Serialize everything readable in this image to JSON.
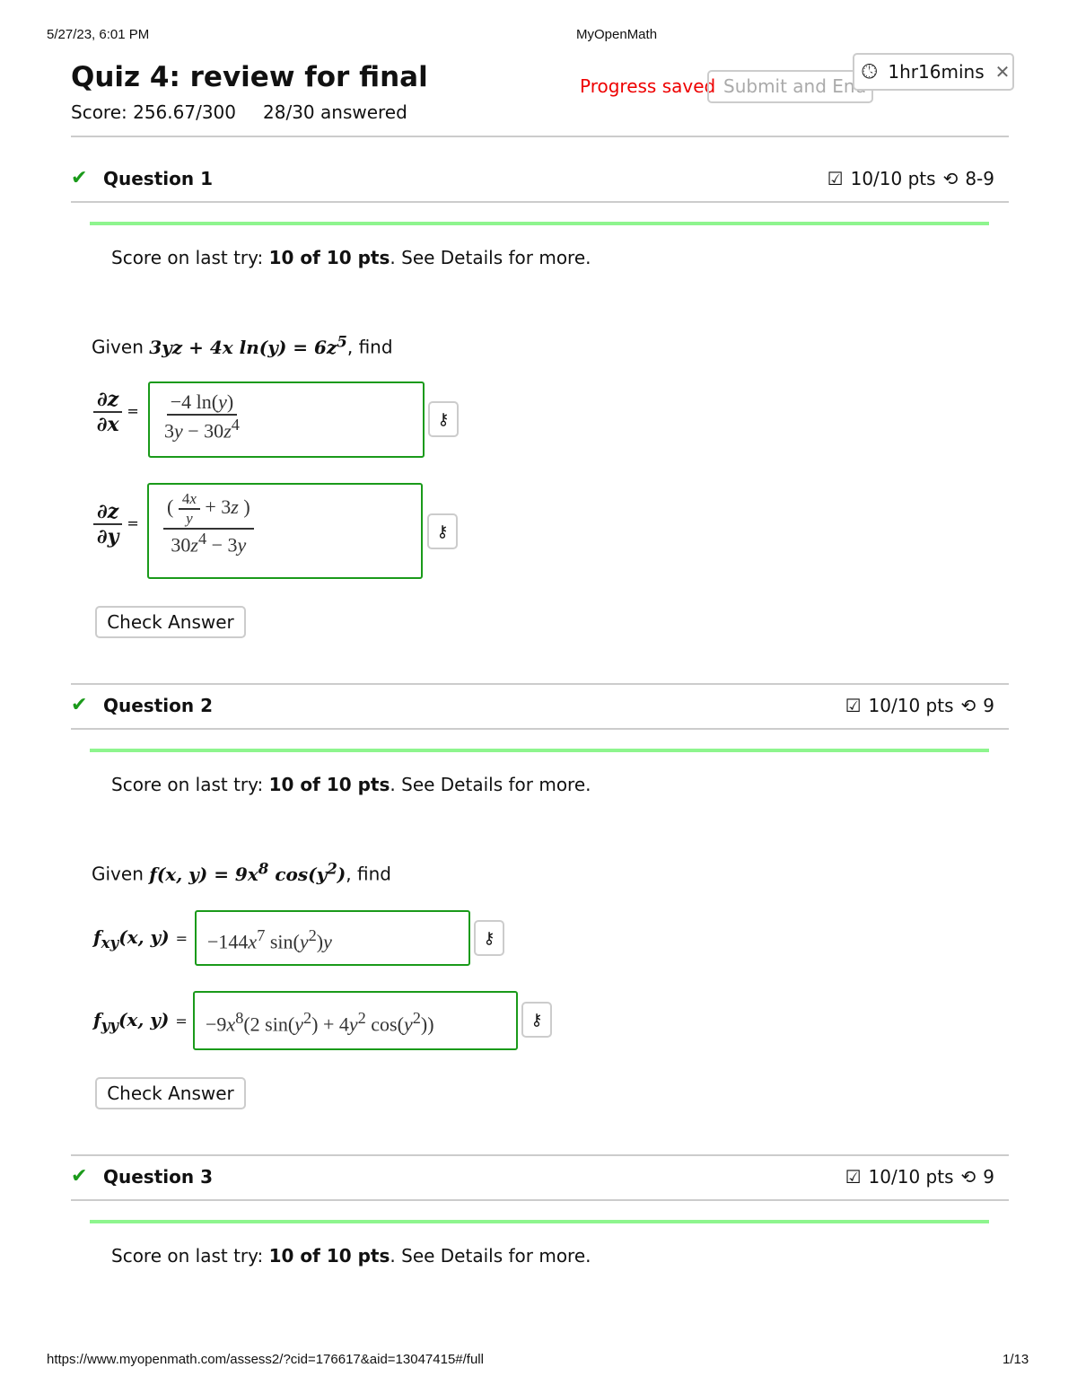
{
  "browser": {
    "datetime": "5/27/23, 6:01 PM",
    "site": "MyOpenMath",
    "url": "https://www.myopenmath.com/assess2/?cid=176617&aid=13047415#/full",
    "page": "1/13"
  },
  "quiz": {
    "title": "Quiz 4: review for final",
    "score": "Score: 256.67/300",
    "answered": "28/30 answered",
    "progress": "Progress saved",
    "submit": "Submit and End",
    "timer": "1hr16mins"
  },
  "questions": [
    {
      "label": "Question 1",
      "pts": "10/10 pts",
      "tries": "8-9",
      "last_pre": "Score on last try: ",
      "last_bold": "10 of 10 pts",
      "last_post": ". See Details for more.",
      "given": "Given",
      "find": ", find",
      "check": "Check Answer"
    },
    {
      "label": "Question 2",
      "pts": "10/10 pts",
      "tries": "9",
      "last_pre": "Score on last try: ",
      "last_bold": "10 of 10 pts",
      "last_post": ". See Details for more.",
      "given": "Given",
      "find": ", find",
      "check": "Check Answer"
    },
    {
      "label": "Question 3",
      "pts": "10/10 pts",
      "tries": "9",
      "last_pre": "Score on last try: ",
      "last_bold": "10 of 10 pts",
      "last_post": ". See Details for more."
    }
  ],
  "colors": {
    "correct": "#1a9a1a",
    "saved": "#e00000",
    "bar": "#8ef58e"
  }
}
